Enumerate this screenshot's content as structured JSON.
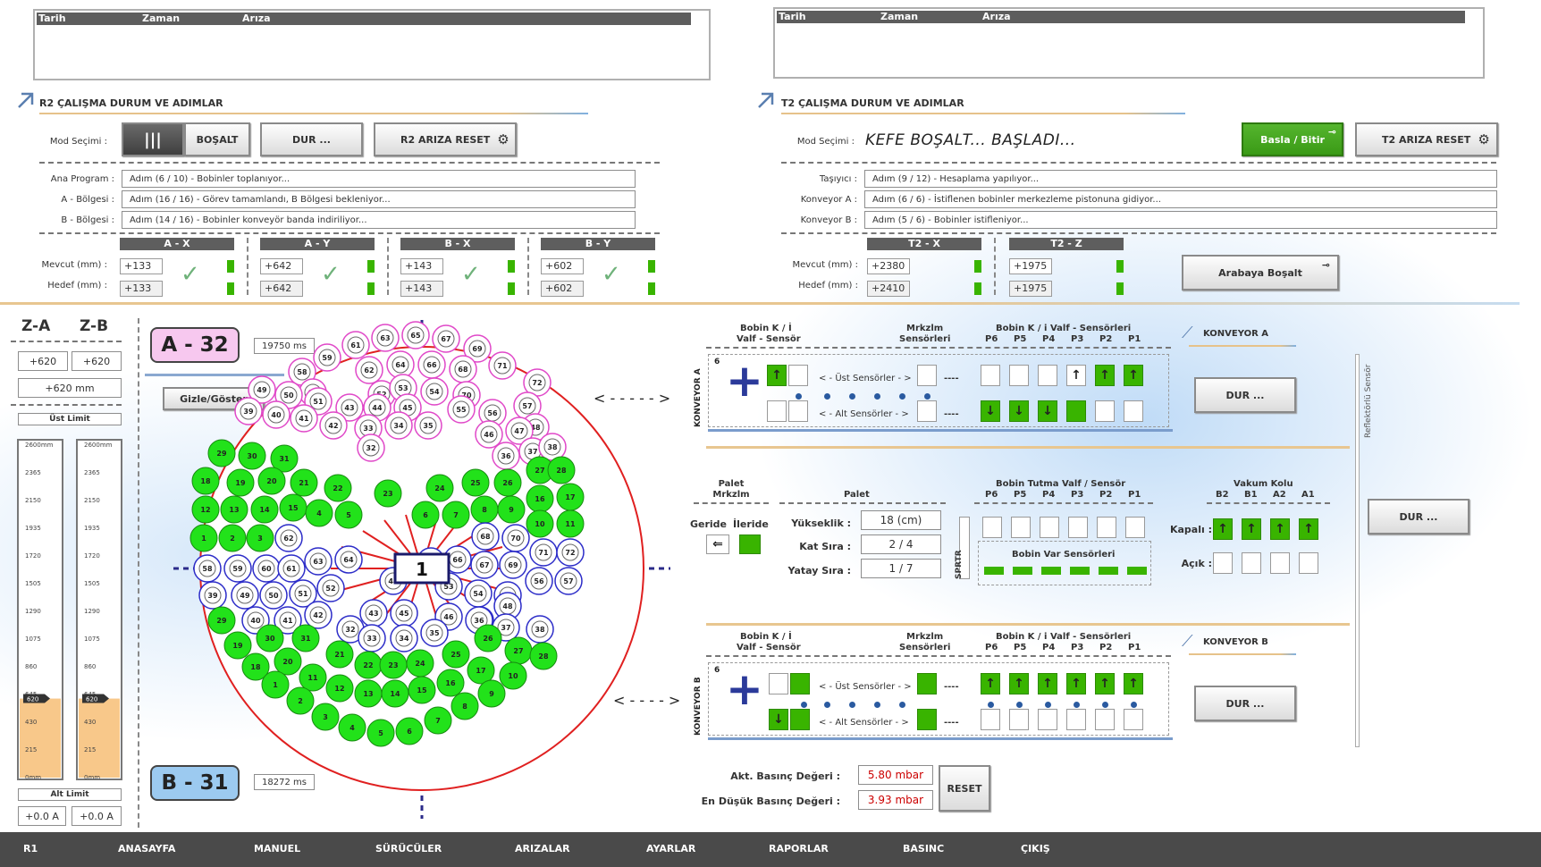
{
  "log_r2": {
    "cols": [
      "Tarih",
      "Zaman",
      "Arıza"
    ]
  },
  "log_t2": {
    "cols": [
      "Tarih",
      "Zaman",
      "Arıza"
    ]
  },
  "r2": {
    "title": "R2 ÇALIŞMA DURUM VE ADIMLAR",
    "mod_label": "Mod Seçimi :",
    "btn_bosalt": "BOŞALT",
    "btn_dur": "DUR ...",
    "btn_reset": "R2 ARIZA RESET",
    "rows": [
      {
        "label": "Ana Program :",
        "value": "Adım (6 / 10) - Bobinler toplanıyor..."
      },
      {
        "label": "A - Bölgesi :",
        "value": "Adım (16 / 16) - Görev tamamlandı, B Bölgesi bekleniyor..."
      },
      {
        "label": "B - Bölgesi :",
        "value": "Adım (14 / 16) - Bobinler konveyör banda indiriliyor..."
      }
    ],
    "mevcut": "Mevcut (mm) :",
    "hedef": "Hedef (mm) :",
    "axes": [
      {
        "name": "A - X",
        "cur": "+133",
        "tgt": "+133"
      },
      {
        "name": "A - Y",
        "cur": "+642",
        "tgt": "+642"
      },
      {
        "name": "B - X",
        "cur": "+143",
        "tgt": "+143"
      },
      {
        "name": "B - Y",
        "cur": "+602",
        "tgt": "+602"
      }
    ]
  },
  "t2": {
    "title": "T2 ÇALIŞMA DURUM VE ADIMLAR",
    "mod_label": "Mod Seçimi :",
    "mod_value": "KEFE BOŞALT... BAŞLADI...",
    "btn_basla": "Basla / Bitir",
    "btn_reset": "T2 ARIZA RESET",
    "rows": [
      {
        "label": "Taşıyıcı :",
        "value": "Adım (9 / 12) - Hesaplama yapılıyor..."
      },
      {
        "label": "Konveyor A :",
        "value": "Adım (6 / 6) - İstiflenen bobinler merkezleme pistonuna gidiyor..."
      },
      {
        "label": "Konveyor B :",
        "value": "Adım (5 / 6) - Bobinler istifleniyor..."
      }
    ],
    "mevcut": "Mevcut (mm) :",
    "hedef": "Hedef (mm) :",
    "axes": [
      {
        "name": "T2 - X",
        "cur": "+2380",
        "tgt": "+2410"
      },
      {
        "name": "T2 - Z",
        "cur": "+1975",
        "tgt": "+1975"
      }
    ],
    "btn_arabaya": "Arabaya Boşalt"
  },
  "z": {
    "za": "Z-A",
    "zb": "Z-B",
    "za_val": "+620",
    "zb_val": "+620",
    "mm": "+620 mm",
    "ust": "Üst Limit",
    "alt": "Alt Limit",
    "amp_a": "+0.0  A",
    "amp_b": "+0.0  A",
    "ticks": [
      "2600mm",
      "2365",
      "2150",
      "1935",
      "1720",
      "1505",
      "1290",
      "1075",
      "860",
      "645",
      "430",
      "215",
      "0mm"
    ],
    "marker_a": "620",
    "marker_b": "620",
    "level_fraction": 0.238
  },
  "plate": {
    "a_label": "A - 32",
    "a_ms": "19750  ms",
    "b_label": "B - 31",
    "b_ms": "18272  ms",
    "gizle": "Gizle/Göster",
    "center": "1"
  },
  "conv_a": {
    "title": "KONVEYOR A",
    "vlabel": "KONVEYOR A",
    "h_bobin": "Bobin K / İ",
    "h_valf": "Valf - Sensör",
    "h_mrk": "Mrkzlm",
    "h_sens": "Sensörleri",
    "h_bobin_k": "Bobin K / i Valf - Sensörleri",
    "ust": "< - Üst Sensörler - >",
    "alt": "< - Alt Sensörler - >",
    "count": "6",
    "dur": "DUR ...",
    "dashes": "----"
  },
  "conv_b": {
    "title": "KONVEYOR B",
    "vlabel": "KONVEYOR B",
    "h_bobin": "Bobin K / İ",
    "h_valf": "Valf - Sensör",
    "h_mrk": "Mrkzlm",
    "h_sens": "Sensörleri",
    "h_bobin_k": "Bobin K / i Valf - Sensörleri",
    "ust": "< - Üst Sensörler - >",
    "alt": "< - Alt Sensörler - >",
    "count": "6",
    "dur": "DUR ...",
    "dashes": "----"
  },
  "p_labels": [
    "P6",
    "P5",
    "P4",
    "P3",
    "P2",
    "P1"
  ],
  "palet": {
    "h1": "Palet",
    "h2": "Mrkzlm",
    "geride": "Geride",
    "ileride": "İleride",
    "palet": "Palet",
    "yukseklik": "Yükseklik :",
    "yukseklik_v": "18  (cm)",
    "kat": "Kat Sıra :",
    "kat_v": "2 / 4",
    "yatay": "Yatay Sıra :",
    "yatay_v": "1 / 7",
    "sprtr": "SPRTR",
    "tutma": "Bobin Tutma Valf / Sensör",
    "var": "Bobin Var Sensörleri",
    "vakum": "Vakum Kolu",
    "vk_labels": [
      "B2",
      "B1",
      "A2",
      "A1"
    ],
    "kapali": "Kapalı :",
    "acik": "Açık :",
    "dur": "DUR ..."
  },
  "pressure": {
    "akt_label": "Akt. Basınç Değeri :",
    "akt": "5.80  mbar",
    "min_label": "En Düşük Basınç Değeri :",
    "min": "3.93  mbar",
    "reset": "RESET"
  },
  "reflektor": "Reflektörlü Sensör",
  "nav": [
    "R1",
    "ANASAYFA",
    "MANUEL",
    "SÜRÜCÜLER",
    "ARIZALAR",
    "AYARLAR",
    "RAPORLAR",
    "BASINC",
    "ÇIKIŞ"
  ],
  "colors": {
    "green": "#39b400",
    "coil_green": "#22e21a",
    "pink": "#e048c8",
    "blue": "#2c2cc8",
    "red": "#e02020"
  }
}
